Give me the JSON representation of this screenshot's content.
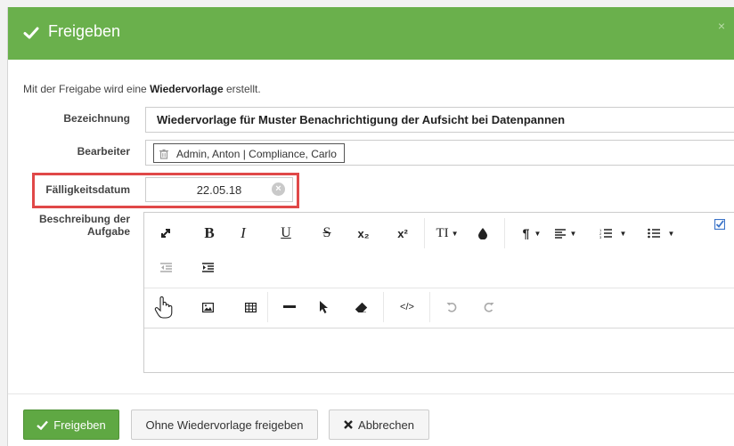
{
  "dialog": {
    "title": "Freigeben",
    "close": "×",
    "intro_prefix": "Mit der Freigabe wird eine ",
    "intro_bold": "Wiedervorlage",
    "intro_suffix": " erstellt."
  },
  "form": {
    "bezeichnung_label": "Bezeichnung",
    "bezeichnung_value": "Wiedervorlage für Muster Benachrichtigung der Aufsicht bei Datenpannen",
    "bearbeiter_label": "Bearbeiter",
    "bearbeiter_tag": "Admin, Anton | Compliance, Carlo",
    "faelligkeit_label": "Fälligkeitsdatum",
    "faelligkeit_value": "22.05.18",
    "beschreibung_label_1": "Beschreibung der",
    "beschreibung_label_2": "Aufgabe"
  },
  "toolbar": {
    "bold": "B",
    "italic": "I",
    "underline": "U",
    "strike": "S",
    "subscript": "x₂",
    "superscript": "x²",
    "font_size": "TI",
    "paragraph": "¶",
    "code": "</>"
  },
  "footer": {
    "primary_label": "Freigeben",
    "secondary_label": "Ohne Wiedervorlage freigeben",
    "cancel_label": "Abbrechen"
  },
  "colors": {
    "header": "#6ab04c",
    "primary_button": "#5fa843",
    "highlight": "#e04848"
  }
}
